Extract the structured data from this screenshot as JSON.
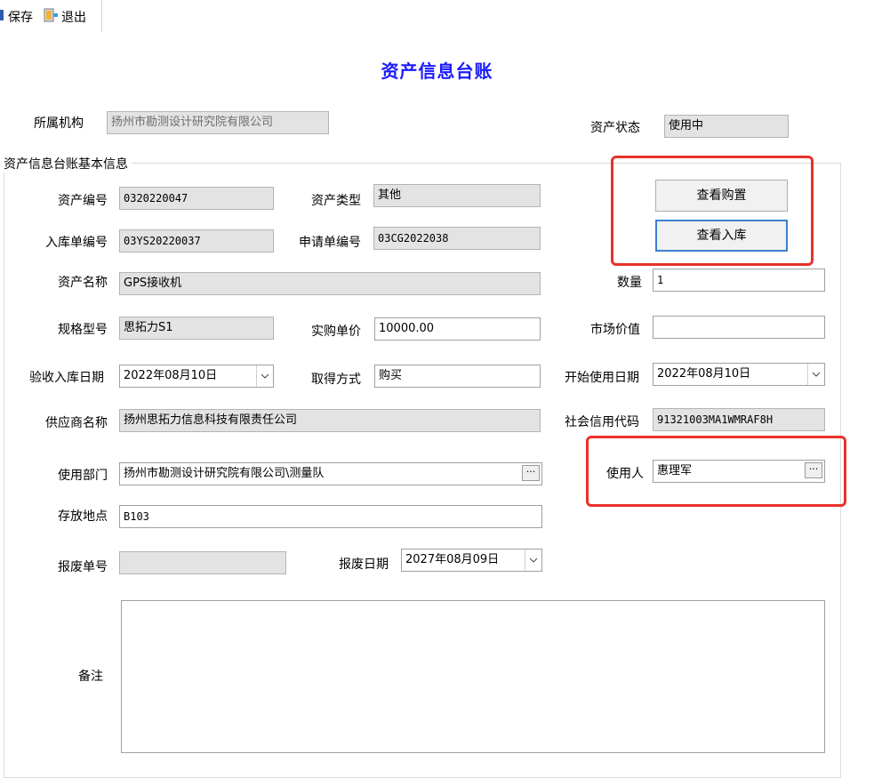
{
  "toolbar": {
    "save_label": "保存",
    "exit_label": "退出"
  },
  "page": {
    "title": "资产信息台账"
  },
  "header": {
    "org_label": "所属机构",
    "org_value": "扬州市勘测设计研究院有限公司",
    "status_label": "资产状态",
    "status_value": "使用中"
  },
  "group": {
    "title": "资产信息台账基本信息"
  },
  "buttons": {
    "view_purchase": "查看购置",
    "view_storage": "查看入库"
  },
  "form": {
    "asset_no_label": "资产编号",
    "asset_no": "0320220047",
    "asset_type_label": "资产类型",
    "asset_type": "其他",
    "storage_no_label": "入库单编号",
    "storage_no": "03YS20220037",
    "apply_no_label": "申请单编号",
    "apply_no": "03CG2022038",
    "asset_name_label": "资产名称",
    "asset_name": "GPS接收机",
    "quantity_label": "数量",
    "quantity": "1",
    "model_label": "规格型号",
    "model": "思拓力S1",
    "unit_price_label": "实购单价",
    "unit_price": "10000.00",
    "market_value_label": "市场价值",
    "market_value": "",
    "accept_date_label": "验收入库日期",
    "accept_date": "2022年08月10日",
    "acquire_method_label": "取得方式",
    "acquire_method": "购买",
    "start_date_label": "开始使用日期",
    "start_date": "2022年08月10日",
    "supplier_label": "供应商名称",
    "supplier": "扬州思拓力信息科技有限责任公司",
    "credit_code_label": "社会信用代码",
    "credit_code": "91321003MA1WMRAF8H",
    "dept_label": "使用部门",
    "dept": "扬州市勘测设计研究院有限公司\\测量队",
    "user_label": "使用人",
    "user": "惠理军",
    "location_label": "存放地点",
    "location": "B103",
    "scrap_no_label": "报废单号",
    "scrap_no": "",
    "scrap_date_label": "报废日期",
    "scrap_date": "2027年08月09日",
    "remark_label": "备注",
    "remark": ""
  },
  "colors": {
    "title": "#1a1aff",
    "highlight": "#e8322a",
    "focus_border": "#3c7fd0"
  }
}
